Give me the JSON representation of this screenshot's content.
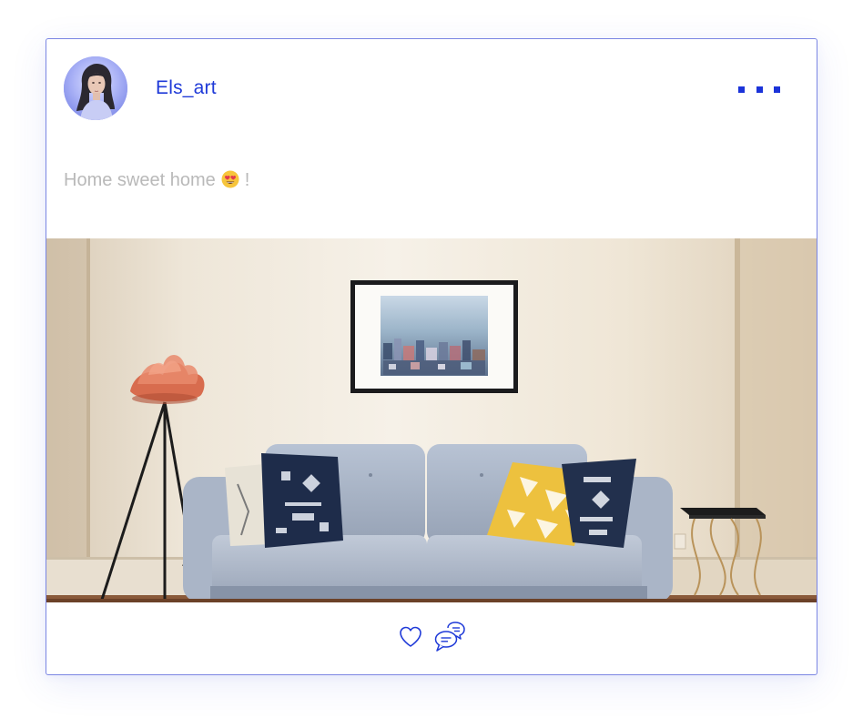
{
  "post": {
    "username": "Els_art",
    "caption_before": "Home sweet home",
    "caption_after": "!",
    "caption_emoji": "heart-eyes-emoji"
  },
  "header": {
    "more_menu_icon": "more-dots-icon"
  },
  "actions": {
    "like_icon": "heart-icon",
    "comment_icon": "comment-bubbles-icon"
  },
  "colors": {
    "accent": "#1f3ad8",
    "border": "#7b86e3",
    "caption": "#b9b9b9"
  }
}
